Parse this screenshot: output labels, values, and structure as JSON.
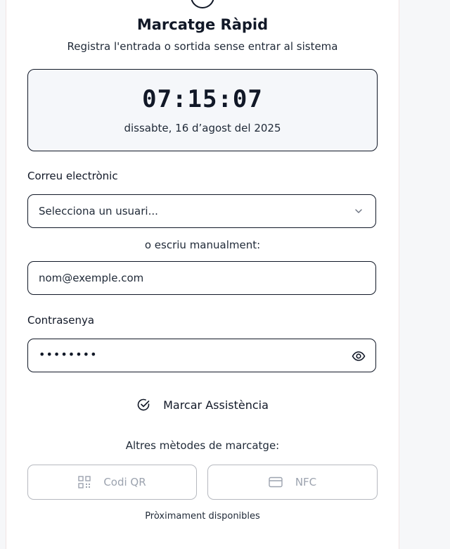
{
  "header": {
    "title": "Marcatge Ràpid",
    "subtitle": "Registra l'entrada o sortida sense entrar al sistema"
  },
  "clock": {
    "time": "07:15:07",
    "date": "dissabte, 16 d’agost del 2025"
  },
  "email": {
    "label": "Correu electrònic",
    "select_value": "Selecciona un usuari...",
    "or_text": "o escriu manualment:",
    "input_placeholder": "nom@exemple.com"
  },
  "password": {
    "label": "Contrasenya",
    "value": "••••••••",
    "icon": "eye-icon"
  },
  "submit": {
    "label": "Marcar Assistència",
    "icon": "check-circle-icon"
  },
  "methods": {
    "title": "Altres mètodes de marcatge:",
    "qr_label": "Codi QR",
    "nfc_label": "NFC",
    "note": "Pròximament disponibles"
  },
  "colors": {
    "border": "#111827",
    "disabled": "#9ca3af",
    "clock_bg": "#f5f7fa"
  }
}
